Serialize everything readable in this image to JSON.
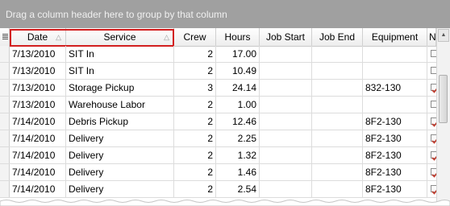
{
  "group_panel": {
    "text": "Drag a column header here to group by that column"
  },
  "columns": [
    {
      "label": "Date",
      "sort_icon": "sort-up-icon"
    },
    {
      "label": "Service",
      "sort_icon": "sort-up-icon"
    },
    {
      "label": "Crew"
    },
    {
      "label": "Hours"
    },
    {
      "label": "Job Start"
    },
    {
      "label": "Job End"
    },
    {
      "label": "Equipment"
    },
    {
      "label": "N"
    }
  ],
  "rows": [
    {
      "date": "7/13/2010",
      "service": "SIT In",
      "crew": "2",
      "hours": "17.00",
      "job_start": "",
      "job_end": "",
      "equipment": "",
      "checked": false
    },
    {
      "date": "7/13/2010",
      "service": "SIT In",
      "crew": "2",
      "hours": "10.49",
      "job_start": "",
      "job_end": "",
      "equipment": "",
      "checked": false
    },
    {
      "date": "7/13/2010",
      "service": "Storage Pickup",
      "crew": "3",
      "hours": "24.14",
      "job_start": "",
      "job_end": "",
      "equipment": "832-130",
      "checked": true
    },
    {
      "date": "7/13/2010",
      "service": "Warehouse Labor",
      "crew": "2",
      "hours": "1.00",
      "job_start": "",
      "job_end": "",
      "equipment": "",
      "checked": false
    },
    {
      "date": "7/14/2010",
      "service": "Debris Pickup",
      "crew": "2",
      "hours": "12.46",
      "job_start": "",
      "job_end": "",
      "equipment": "8F2-130",
      "checked": true
    },
    {
      "date": "7/14/2010",
      "service": "Delivery",
      "crew": "2",
      "hours": "2.25",
      "job_start": "",
      "job_end": "",
      "equipment": "8F2-130",
      "checked": true
    },
    {
      "date": "7/14/2010",
      "service": "Delivery",
      "crew": "2",
      "hours": "1.32",
      "job_start": "",
      "job_end": "",
      "equipment": "8F2-130",
      "checked": true
    },
    {
      "date": "7/14/2010",
      "service": "Delivery",
      "crew": "2",
      "hours": "1.46",
      "job_start": "",
      "job_end": "",
      "equipment": "8F2-130",
      "checked": true
    },
    {
      "date": "7/14/2010",
      "service": "Delivery",
      "crew": "2",
      "hours": "2.54",
      "job_start": "",
      "job_end": "",
      "equipment": "8F2-130",
      "checked": true
    }
  ],
  "colors": {
    "highlight": "#d21f1f",
    "group_panel": "#a0a0a0",
    "check": "#c0392b"
  }
}
